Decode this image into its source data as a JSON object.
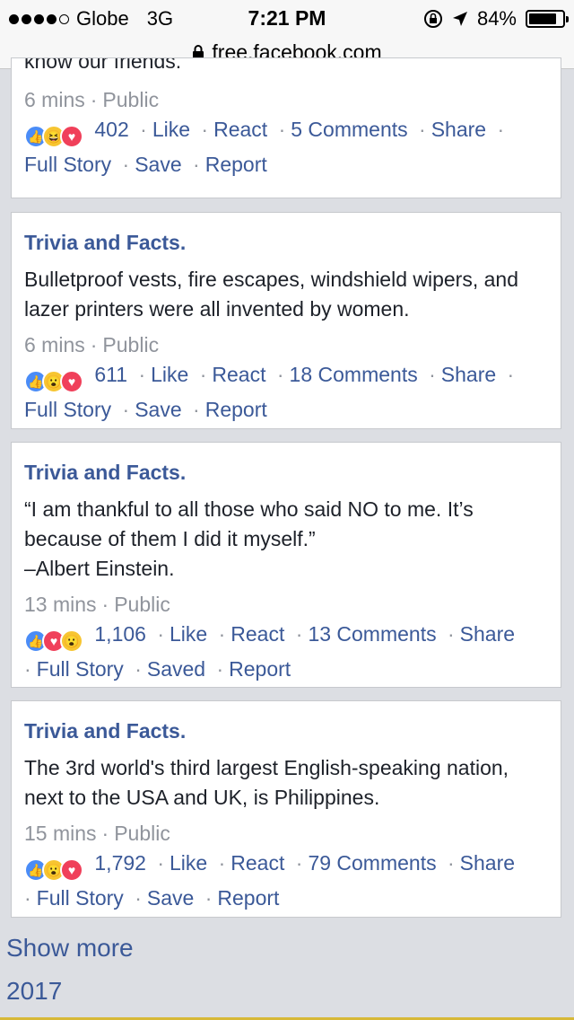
{
  "status_bar": {
    "carrier": "Globe",
    "network": "3G",
    "time": "7:21 PM",
    "battery": "84%",
    "battery_level": 0.84
  },
  "url_bar": {
    "url": "free.facebook.com"
  },
  "top_card": {
    "body_tail": "know our friends.",
    "time": "6 mins",
    "privacy": "Public",
    "reactions": [
      "like",
      "haha",
      "love"
    ],
    "count": "402",
    "like": "Like",
    "react": "React",
    "comments": "5 Comments",
    "share": "Share",
    "full_story": "Full Story",
    "save": "Save",
    "report": "Report"
  },
  "posts": [
    {
      "title": "Trivia and Facts.",
      "body": "Bulletproof vests, fire escapes, windshield wipers, and lazer printers were all invented by women.",
      "time": "6 mins",
      "privacy": "Public",
      "reactions": [
        "like",
        "wow",
        "love"
      ],
      "count": "611",
      "like": "Like",
      "react": "React",
      "comments": "18 Comments",
      "share": "Share",
      "full_story": "Full Story",
      "save": "Save",
      "report": "Report"
    },
    {
      "title": "Trivia and Facts.",
      "body": "“I am thankful to all those who said NO to me. It’s because of them I did it myself.”",
      "body2": "–Albert Einstein.",
      "time": "13 mins",
      "privacy": "Public",
      "reactions": [
        "like",
        "love",
        "wow"
      ],
      "count": "1,106",
      "like": "Like",
      "react": "React",
      "comments": "13 Comments",
      "share": "Share",
      "full_story": "Full Story",
      "save": "Saved",
      "report": "Report"
    },
    {
      "title": "Trivia and Facts.",
      "body": "The 3rd world's third largest English-speaking nation, next to the USA and UK, is Philippines.",
      "time": "15 mins",
      "privacy": "Public",
      "reactions": [
        "like",
        "wow",
        "love"
      ],
      "count": "1,792",
      "like": "Like",
      "react": "React",
      "comments": "79 Comments",
      "share": "Share",
      "full_story": "Full Story",
      "save": "Save",
      "report": "Report"
    }
  ],
  "footer": {
    "show_more": "Show more",
    "year": "2017"
  }
}
